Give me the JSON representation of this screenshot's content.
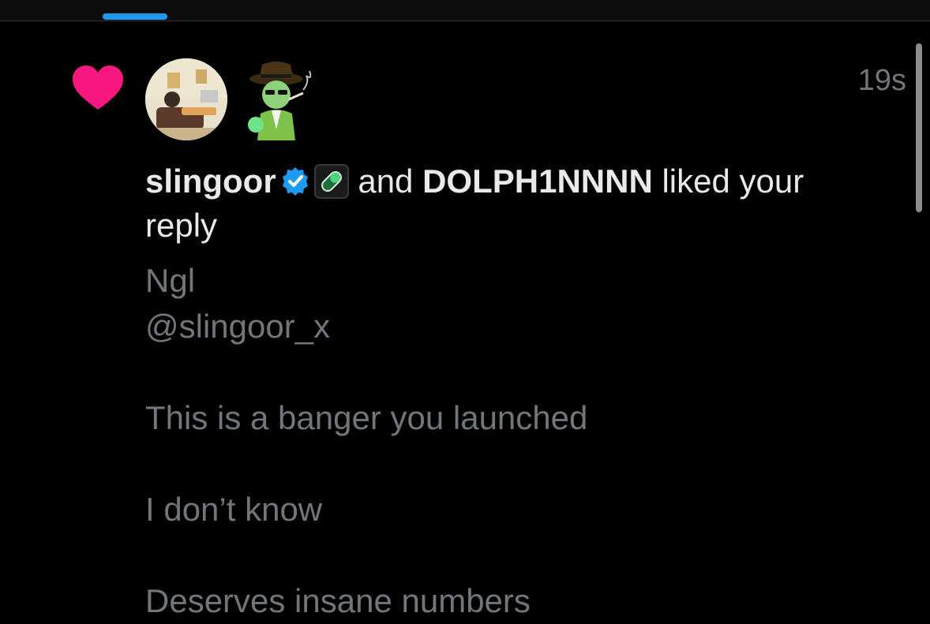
{
  "notification": {
    "timestamp": "19s",
    "actor_1": "slingoor",
    "actor_2": "DOLPH1NNNN",
    "connector": "and",
    "action_text_1": "liked your",
    "action_text_2": "reply",
    "reply_lines": [
      "Ngl",
      "@slingoor_x",
      "",
      "This is a banger you launched",
      "",
      "I don’t know",
      "",
      "Deserves insane numbers"
    ],
    "icons": {
      "type": "heart-icon",
      "badge": "verified-icon",
      "affiliate": "pill-icon"
    }
  },
  "colors": {
    "background": "#000000",
    "heart": "#f91880",
    "accent": "#1d9bf0",
    "text_primary": "#e7e9ea",
    "text_secondary": "#71767b"
  }
}
